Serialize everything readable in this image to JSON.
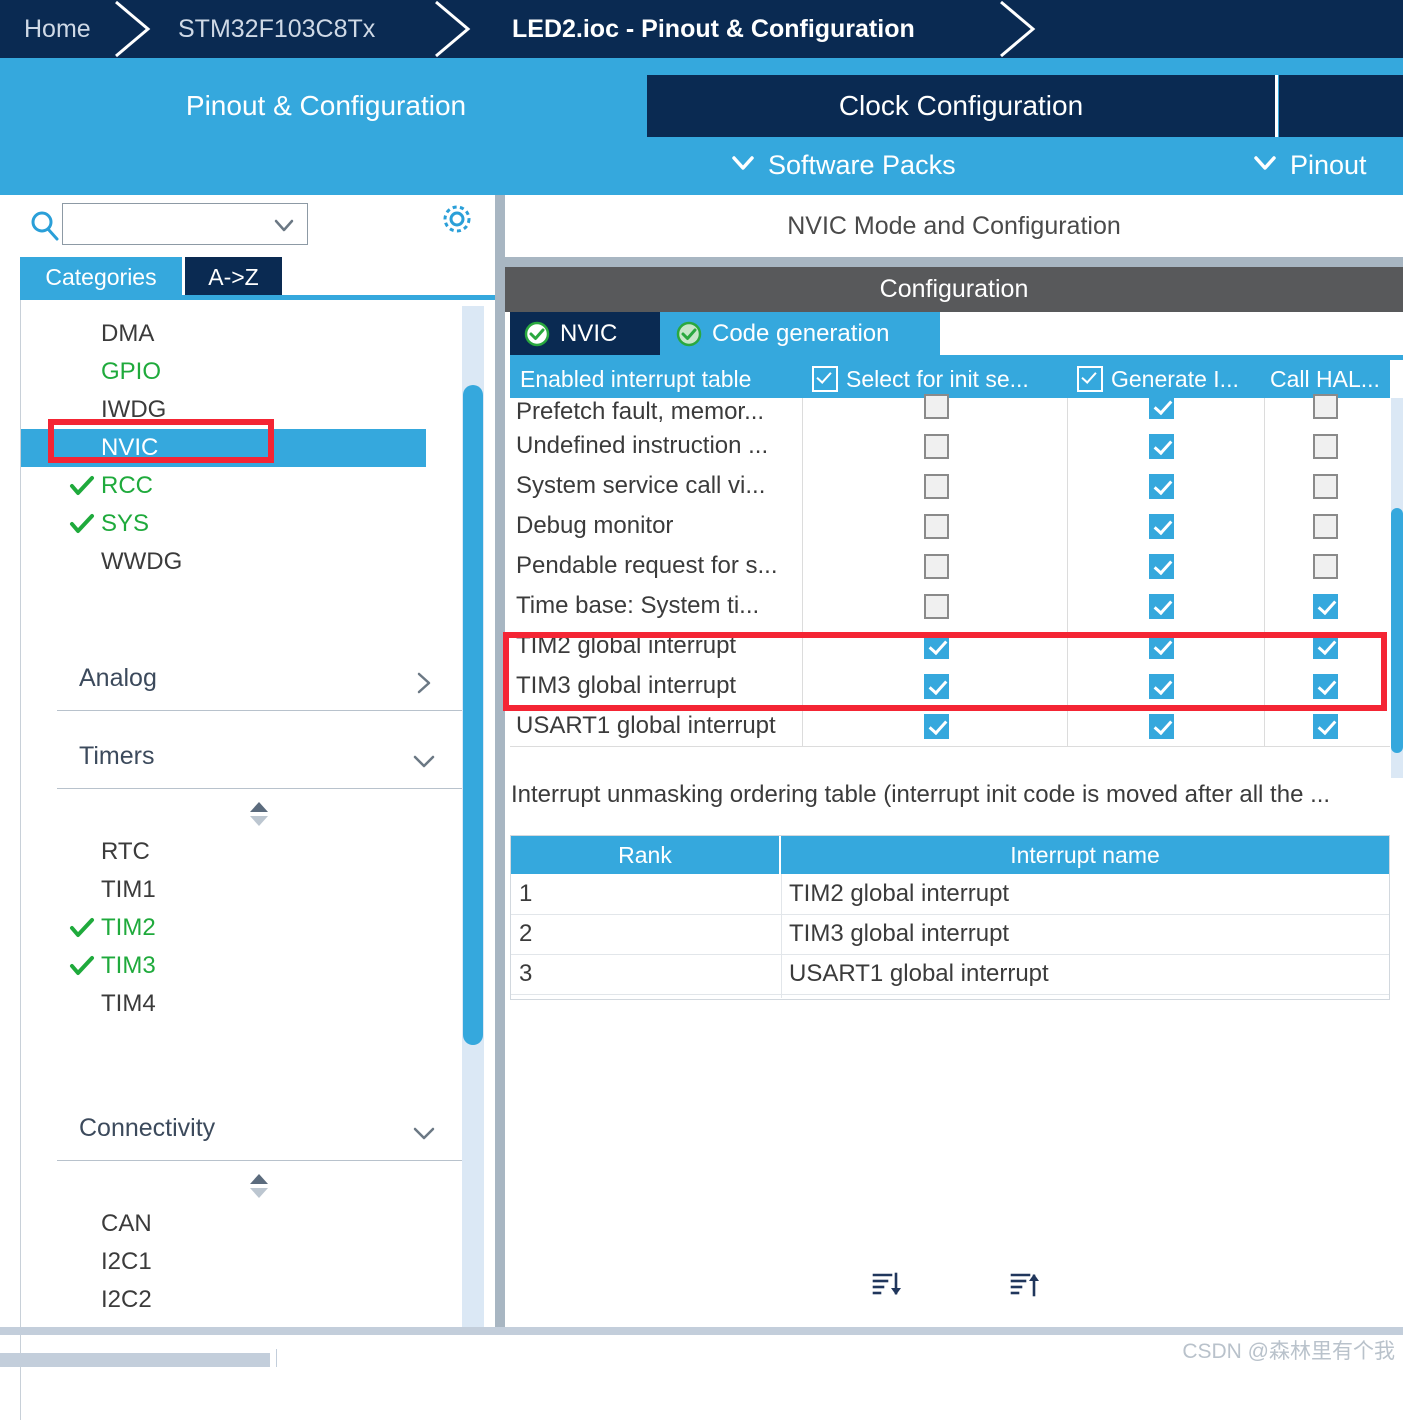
{
  "breadcrumb": {
    "items": [
      {
        "label": "Home",
        "strong": false
      },
      {
        "label": "STM32F103C8Tx",
        "strong": false
      },
      {
        "label": "LED2.ioc - Pinout & Configuration",
        "strong": true
      }
    ]
  },
  "tabs": {
    "items": [
      {
        "label": "Pinout & Configuration",
        "active": true
      },
      {
        "label": "Clock Configuration",
        "active": false
      }
    ],
    "subtabs": [
      {
        "label": "Software Packs",
        "icon": "chevron-down-icon"
      },
      {
        "label": "Pinout",
        "icon": "chevron-down-icon"
      }
    ]
  },
  "sidebar": {
    "search": {
      "value": "",
      "placeholder": "",
      "icon": "search-icon",
      "caret": "chevron-down-icon"
    },
    "settings_icon": "gear-icon",
    "tabs": [
      {
        "label": "Categories",
        "selected": true
      },
      {
        "label": "A->Z",
        "selected": false
      }
    ],
    "peripherals": [
      {
        "label": "DMA",
        "state": "none",
        "selected": false
      },
      {
        "label": "GPIO",
        "state": "green",
        "selected": false
      },
      {
        "label": "IWDG",
        "state": "none",
        "selected": false
      },
      {
        "label": "NVIC",
        "state": "none",
        "selected": true
      },
      {
        "label": "RCC",
        "state": "checked",
        "selected": false
      },
      {
        "label": "SYS",
        "state": "checked",
        "selected": false
      },
      {
        "label": "WWDG",
        "state": "none",
        "selected": false
      }
    ],
    "sections": [
      {
        "title": "Analog",
        "expanded": false,
        "chevron": "chevron-right-icon",
        "items": []
      },
      {
        "title": "Timers",
        "expanded": true,
        "chevron": "chevron-down-icon",
        "items": [
          {
            "label": "RTC",
            "state": "none"
          },
          {
            "label": "TIM1",
            "state": "none"
          },
          {
            "label": "TIM2",
            "state": "checked"
          },
          {
            "label": "TIM3",
            "state": "checked"
          },
          {
            "label": "TIM4",
            "state": "none"
          }
        ]
      },
      {
        "title": "Connectivity",
        "expanded": true,
        "chevron": "chevron-down-icon",
        "items": [
          {
            "label": "CAN",
            "state": "none"
          },
          {
            "label": "I2C1",
            "state": "none"
          },
          {
            "label": "I2C2",
            "state": "none"
          }
        ]
      }
    ]
  },
  "main": {
    "title": "NVIC Mode and Configuration",
    "configuration_label": "Configuration",
    "config_tabs": [
      {
        "label": "NVIC",
        "selected": true,
        "icon": "check-circle-icon"
      },
      {
        "label": "Code generation",
        "selected": false,
        "icon": "check-circle-icon"
      }
    ],
    "interrupt_table": {
      "columns": [
        {
          "label": "Enabled interrupt table",
          "has_checkbox": false
        },
        {
          "label": "Select for init se...",
          "has_checkbox": true
        },
        {
          "label": "Generate I...",
          "has_checkbox": true
        },
        {
          "label": "Call HAL...",
          "has_checkbox": false
        }
      ],
      "rows": [
        {
          "name": "Prefetch fault, memor...",
          "select_init": false,
          "generate": true,
          "call_hal": false,
          "clipped": true
        },
        {
          "name": "Undefined instruction ...",
          "select_init": false,
          "generate": true,
          "call_hal": false
        },
        {
          "name": "System service call vi...",
          "select_init": false,
          "generate": true,
          "call_hal": false
        },
        {
          "name": "Debug monitor",
          "select_init": false,
          "generate": true,
          "call_hal": false
        },
        {
          "name": "Pendable request for s...",
          "select_init": false,
          "generate": true,
          "call_hal": false
        },
        {
          "name": "Time base: System ti...",
          "select_init": false,
          "generate": true,
          "call_hal": true
        },
        {
          "name": "TIM2 global interrupt",
          "select_init": true,
          "generate": true,
          "call_hal": true,
          "highlighted": true
        },
        {
          "name": "TIM3 global interrupt",
          "select_init": true,
          "generate": true,
          "call_hal": true,
          "highlighted": true
        },
        {
          "name": "USART1 global interrupt",
          "select_init": true,
          "generate": true,
          "call_hal": true
        }
      ]
    },
    "unmask_note": "Interrupt unmasking ordering table (interrupt init code is moved after all the ...",
    "ranking_table": {
      "columns": [
        "Rank",
        "Interrupt name"
      ],
      "rows": [
        {
          "rank": "1",
          "name": "TIM2 global interrupt"
        },
        {
          "rank": "2",
          "name": "TIM3 global interrupt"
        },
        {
          "rank": "3",
          "name": "USART1 global interrupt"
        }
      ]
    },
    "sort_buttons": [
      {
        "icon": "sort-descending-icon"
      },
      {
        "icon": "sort-ascending-icon"
      }
    ]
  },
  "watermark": "CSDN @森林里有个我",
  "colors": {
    "accent_blue": "#35a8dd",
    "dark_navy": "#0a2a52",
    "green": "#1faa3c",
    "highlight_red": "#f42534",
    "gray_bar": "#58595b"
  }
}
